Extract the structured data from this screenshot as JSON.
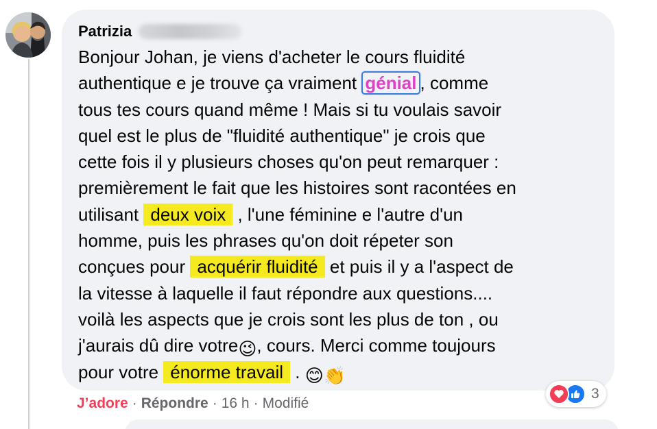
{
  "comment": {
    "author_name": "Patrizia",
    "lines": [
      [
        "Bonjour Johan, je viens d'acheter le cours fluidité"
      ],
      [
        "authentique e je trouve ça vraiment ",
        "génial",
        ", comme"
      ],
      [
        "tous tes cours quand même ! Mais si tu voulais savoir"
      ],
      [
        "quel est le plus de \"fluidité authentique\" je crois que"
      ],
      [
        "cette fois il y plusieurs choses qu'on peut remarquer :"
      ],
      [
        "premièrement le fait que les histoires sont racontées en"
      ],
      [
        "utilisant ",
        "deux voix",
        " , l'une féminine e l'autre d'un"
      ],
      [
        "homme, puis les phrases qu'on doit répeter son"
      ],
      [
        "conçues pour ",
        "acquérir fluidité",
        " et puis il y a l'aspect de"
      ],
      [
        "la vitesse à laquelle il faut répondre aux questions...."
      ],
      [
        "voilà les aspects que je crois sont les plus de ton , ou"
      ],
      [
        "j'aurais dû dire votre",
        "😉",
        ", cours. Merci comme toujours"
      ],
      [
        "pour votre ",
        "énorme travail",
        " . ",
        "😊👏"
      ]
    ]
  },
  "actions": {
    "love_label": "J’adore",
    "reply_label": "Répondre",
    "separator": "·",
    "time": "16 h",
    "edited": "Modifié"
  },
  "reactions": {
    "count": "3",
    "types": [
      "love-icon",
      "like-icon"
    ]
  },
  "colors": {
    "bubble": "#f0f2f5",
    "highlight": "#f5ea1f",
    "love": "#f33e58",
    "like": "#1877f2",
    "meta_text": "#65676b",
    "genial_text": "#e040c8",
    "genial_border": "#3d7be0"
  }
}
